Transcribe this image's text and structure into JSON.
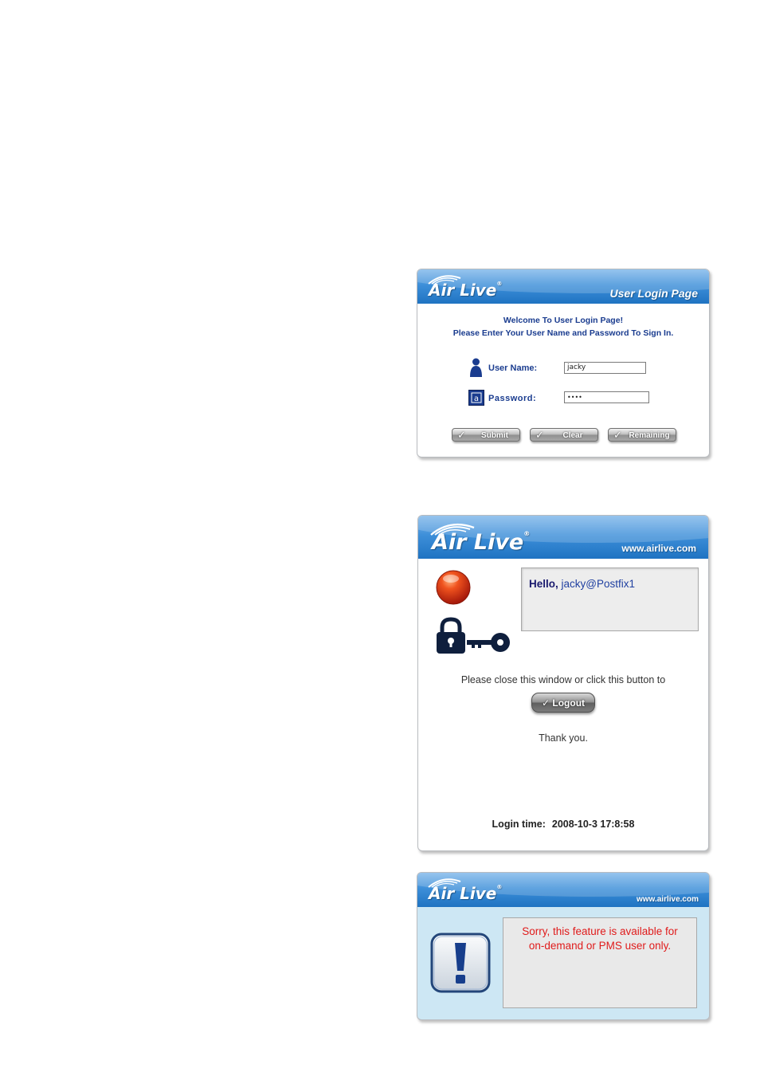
{
  "login_panel": {
    "logo": "Air Live",
    "logo_reg": "®",
    "header_title": "User Login Page",
    "welcome_line1": "Welcome To User Login Page!",
    "welcome_line2": "Please Enter Your User Name and Password To Sign In.",
    "username_label": "User Name:",
    "username_value": "jacky",
    "password_label": "Password:",
    "password_value": "••••",
    "buttons": {
      "submit": "Submit",
      "clear": "Clear",
      "remaining": "Remaining"
    },
    "icons": [
      "user-icon",
      "password-icon",
      "check-icon"
    ]
  },
  "success_panel": {
    "logo": "Air Live",
    "logo_reg": "®",
    "url": "www.airlive.com",
    "hello_label": "Hello,",
    "hello_user": "jacky@Postfix1",
    "close_text": "Please close this window or click this button to",
    "logout_label": "Logout",
    "thank_you": "Thank you.",
    "login_time_label": "Login time:",
    "login_time_value": "2008-10-3 17:8:58",
    "icons": [
      "status-red-icon",
      "lock-key-icon"
    ],
    "colors": {
      "status": "#e02a10",
      "lock": "#0f1f3d"
    }
  },
  "error_panel": {
    "logo": "Air Live",
    "logo_reg": "®",
    "url": "www.airlive.com",
    "message_line1": "Sorry, this feature is available for",
    "message_line2": "on-demand or PMS user only.",
    "icons": [
      "exclamation-icon"
    ],
    "colors": {
      "message": "#e01b1b",
      "background": "#cde7f4"
    }
  }
}
